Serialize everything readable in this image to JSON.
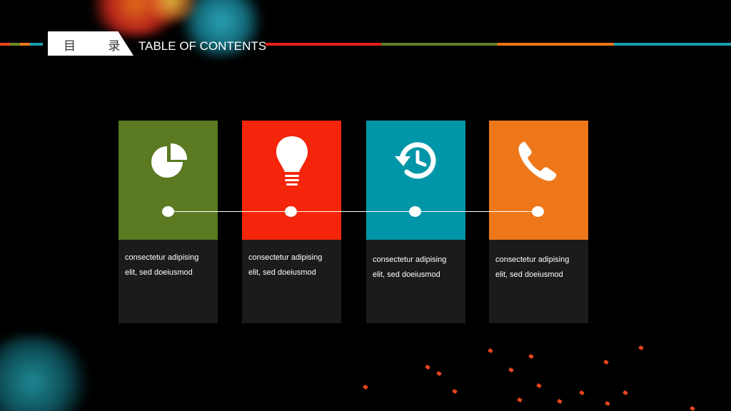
{
  "header": {
    "title_cn": "目 录",
    "title_en": "TABLE OF CONTENTS"
  },
  "colors": {
    "green": "#5b7a22",
    "red": "#f4250a",
    "teal": "#0096a8",
    "orange": "#ee7719",
    "panel": "#1b1b1b"
  },
  "cards": [
    {
      "icon": "pie-chart-icon",
      "line1": "consectetur adipising",
      "line2": "elit, sed doeiusmod"
    },
    {
      "icon": "lightbulb-icon",
      "line1": "consectetur adipising",
      "line2": "elit, sed doeiusmod"
    },
    {
      "icon": "history-clock-icon",
      "line1": "consectetur adipising",
      "line2": "elit, sed doeiusmod"
    },
    {
      "icon": "phone-icon",
      "line1": "consectetur adipising",
      "line2": "elit, sed doeiusmod"
    }
  ]
}
